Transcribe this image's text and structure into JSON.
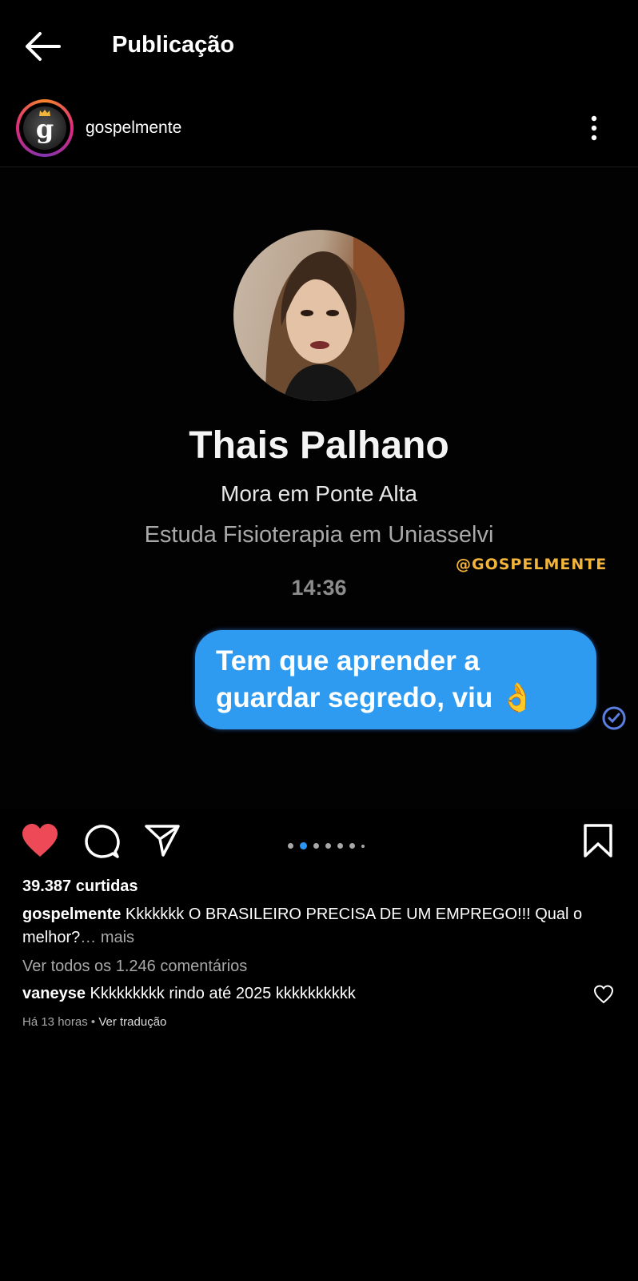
{
  "header": {
    "title": "Publicação"
  },
  "author": {
    "username": "gospelmente",
    "avatar_letter": "g"
  },
  "media": {
    "profile_name": "Thais Palhano",
    "location": "Mora em Ponte Alta",
    "study": "Estuda Fisioterapia em Uniasselvi",
    "watermark": "@GOSPELMENTE",
    "time": "14:36",
    "message": "Tem que aprender a guardar segredo, viu 👌",
    "carousel": {
      "count": 7,
      "active": 2
    }
  },
  "actions": {
    "liked": true,
    "like_color": "#ed4956"
  },
  "post": {
    "likes": "39.387 curtidas",
    "caption_user": "gospelmente",
    "caption_text": "Kkkkkkk O BRASILEIRO PRECISA DE UM EMPREGO!!! Qual o melhor?",
    "caption_more": "… mais",
    "view_all": "Ver todos os 1.246 comentários",
    "comment_user": "vaneyse",
    "comment_text": "Kkkkkkkkk rindo até 2025 kkkkkkkkkk",
    "time_ago": "Há 13 horas",
    "separator": "•",
    "translate": "Ver tradução"
  }
}
